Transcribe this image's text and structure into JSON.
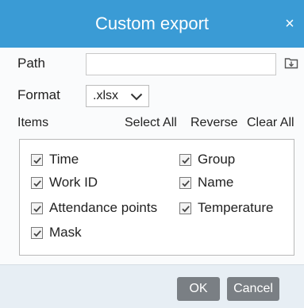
{
  "dialog": {
    "title": "Custom export",
    "close_glyph": "×"
  },
  "path": {
    "label": "Path",
    "value": "",
    "placeholder": "",
    "browse_icon": "folder-import-icon"
  },
  "format": {
    "label": "Format",
    "selected": ".xlsx"
  },
  "items": {
    "label": "Items",
    "select_all": "Select All",
    "reverse": "Reverse",
    "clear_all": "Clear All",
    "list": [
      {
        "label": "Time",
        "checked": true
      },
      {
        "label": "Group",
        "checked": true
      },
      {
        "label": "Work ID",
        "checked": true
      },
      {
        "label": "Name",
        "checked": true
      },
      {
        "label": "Attendance points",
        "checked": true
      },
      {
        "label": "Temperature",
        "checked": true
      },
      {
        "label": "Mask",
        "checked": true
      }
    ]
  },
  "footer": {
    "ok_label": "OK",
    "cancel_label": "Cancel"
  },
  "colors": {
    "titlebar": "#3a9bd5",
    "footer": "#e7eef4",
    "button": "#7a7f84"
  }
}
